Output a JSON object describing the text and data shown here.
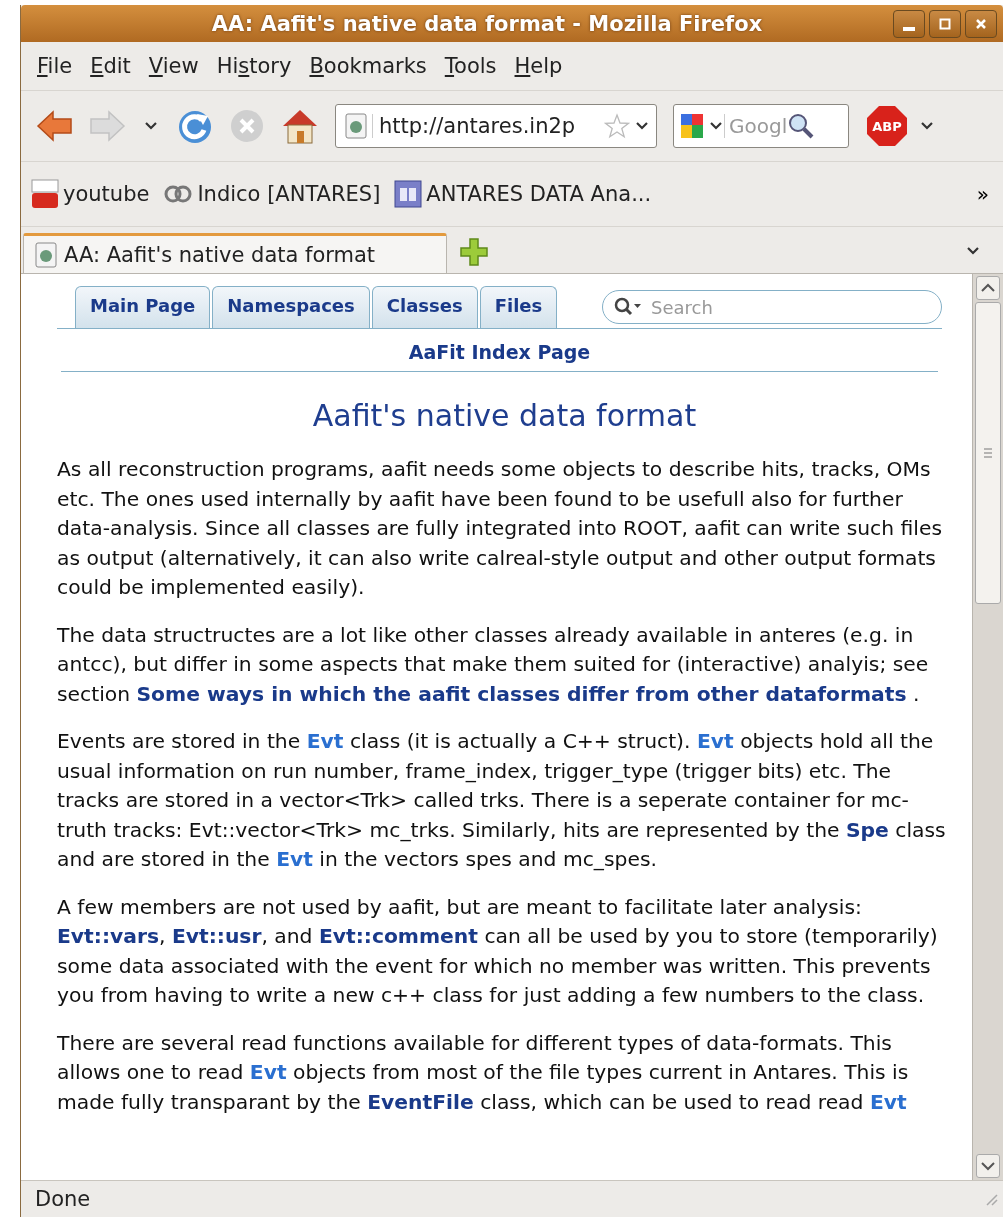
{
  "window": {
    "title": "AA: Aafit's native data format - Mozilla Firefox"
  },
  "menu": [
    {
      "accesskey": "F",
      "label_after": "ile"
    },
    {
      "accesskey": "E",
      "label_after": "dit"
    },
    {
      "accesskey": "V",
      "label_after": "iew"
    },
    {
      "label_before": "Hi",
      "accesskey": "s",
      "label_after": "tory"
    },
    {
      "accesskey": "B",
      "label_after": "ookmarks"
    },
    {
      "accesskey": "T",
      "label_after": "ools"
    },
    {
      "accesskey": "H",
      "label_after": "elp"
    }
  ],
  "toolbar": {
    "back_disabled": false,
    "forward_disabled": true,
    "stop_disabled": true,
    "url": "http://antares.in2p",
    "search_placeholder": "Googl",
    "adblock_label": "ABP"
  },
  "bookmarks": [
    {
      "label": "youtube",
      "kind": "video"
    },
    {
      "label": "Indico [ANTARES]",
      "kind": "rings"
    },
    {
      "label": "ANTARES DATA Ana...",
      "kind": "doc"
    }
  ],
  "bookmarks_overflow": "»",
  "tabs": [
    {
      "label": "AA: Aafit's native data format",
      "selected": true
    }
  ],
  "page": {
    "nav_tabs": [
      {
        "label": "Main Page"
      },
      {
        "label": "Namespaces"
      },
      {
        "label": "Classes"
      },
      {
        "label": "Files"
      }
    ],
    "search_placeholder": "Search",
    "index_title": "AaFit Index Page",
    "heading": "Aafit's native data format",
    "paragraphs": [
      {
        "segments": [
          {
            "kind": "text",
            "text": "As all reconstruction programs, aafit needs some objects to describe hits, tracks, OMs etc. The ones used internally by aafit have been found to be usefull also for further data-analysis. Since all classes are fully integrated into ROOT, aafit can write such files as output (alternatively, it can also write calreal-style output and other output formats could be implemented easily)."
          }
        ]
      },
      {
        "segments": [
          {
            "kind": "text",
            "text": "The data structructes are a lot like other classes already available in anteres (e.g. in antcc), but differ in some aspects that make them suited for (interactive) analyis; see section "
          },
          {
            "kind": "link",
            "text": "Some ways in which the aafit classes differ from other dataformats",
            "visited": true
          },
          {
            "kind": "text",
            "text": " ."
          }
        ]
      },
      {
        "segments": [
          {
            "kind": "text",
            "text": "Events are stored in the "
          },
          {
            "kind": "link",
            "text": "Evt",
            "visited": false
          },
          {
            "kind": "text",
            "text": " class (it is actually a C++ struct). "
          },
          {
            "kind": "link",
            "text": "Evt",
            "visited": false
          },
          {
            "kind": "text",
            "text": " objects hold all the usual information on run number, frame_index, trigger_type (trigger bits) etc. The tracks are stored in a vector<Trk> called trks. There is a seperate container for mc-truth tracks: Evt::vector<Trk> mc_trks. Similarly, hits are represented by the "
          },
          {
            "kind": "link",
            "text": "Spe",
            "visited": true
          },
          {
            "kind": "text",
            "text": " class and are stored in the "
          },
          {
            "kind": "link",
            "text": "Evt",
            "visited": false
          },
          {
            "kind": "text",
            "text": " in the vectors spes and mc_spes."
          }
        ]
      },
      {
        "segments": [
          {
            "kind": "text",
            "text": "A few members are not used by aafit, but are meant to facilitate later analysis: "
          },
          {
            "kind": "link",
            "text": "Evt::vars",
            "visited": true
          },
          {
            "kind": "text",
            "text": ", "
          },
          {
            "kind": "link",
            "text": "Evt::usr",
            "visited": true
          },
          {
            "kind": "text",
            "text": ", and "
          },
          {
            "kind": "link",
            "text": "Evt::comment",
            "visited": true
          },
          {
            "kind": "text",
            "text": " can all be used by you to store (temporarily) some data associated with the event for which no member was written. This prevents you from having to write a new c++ class for just adding a few numbers to the class."
          }
        ]
      },
      {
        "segments": [
          {
            "kind": "text",
            "text": "There are several read functions available for different types of data-formats. This allows one to read "
          },
          {
            "kind": "link",
            "text": "Evt",
            "visited": false
          },
          {
            "kind": "text",
            "text": " objects from most of the file types current in Antares. This is made fully transparant by the "
          },
          {
            "kind": "link",
            "text": "EventFile",
            "visited": true
          },
          {
            "kind": "text",
            "text": " class, which can be used to read read "
          },
          {
            "kind": "link",
            "text": "Evt",
            "visited": false
          }
        ]
      }
    ]
  },
  "status_bar": "Done"
}
